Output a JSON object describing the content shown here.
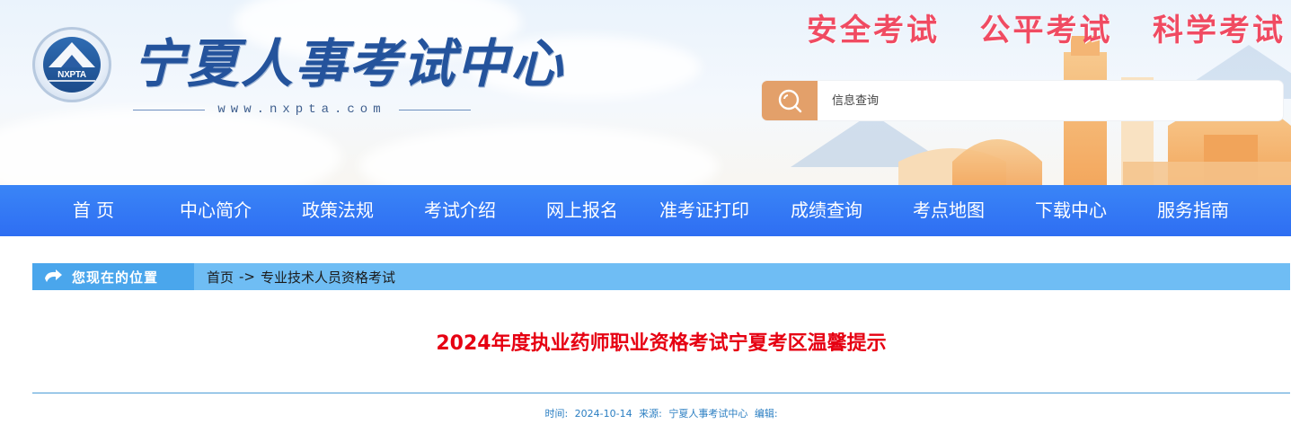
{
  "header": {
    "logo_text": "NXPTA",
    "site_title": "宁夏人事考试中心",
    "site_url": "www.nxpta.com",
    "slogan": "安全考试   公平考试   科学考试",
    "search": {
      "placeholder": "信息查询",
      "icon": "search-icon"
    }
  },
  "nav": {
    "items": [
      {
        "label": "首 页"
      },
      {
        "label": "中心简介"
      },
      {
        "label": "政策法规"
      },
      {
        "label": "考试介绍"
      },
      {
        "label": "网上报名"
      },
      {
        "label": "准考证打印"
      },
      {
        "label": "成绩查询"
      },
      {
        "label": "考点地图"
      },
      {
        "label": "下载中心"
      },
      {
        "label": "服务指南"
      }
    ]
  },
  "breadcrumb": {
    "label": "您现在的位置",
    "home": "首页",
    "separator": "->",
    "current": "专业技术人员资格考试"
  },
  "article": {
    "title": "2024年度执业药师职业资格考试宁夏考区温馨提示",
    "meta": {
      "time_label": "时间:",
      "time_value": "2024-10-14",
      "source_label": "来源:",
      "source_value": "宁夏人事考试中心",
      "editor_label": "编辑:"
    }
  },
  "colors": {
    "nav_bg": "#3a85f7",
    "slogan": "#f04b62",
    "title_red": "#e60012",
    "breadcrumb_bg": "#6fbdf4",
    "search_btn": "#e3a06a"
  }
}
